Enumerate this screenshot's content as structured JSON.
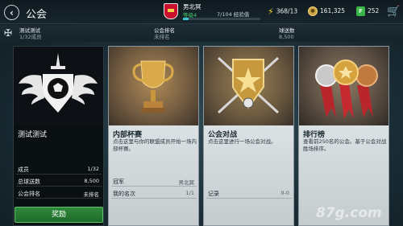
{
  "header": {
    "back_icon": "chevron-left-icon",
    "title": "公会",
    "profile": {
      "name": "男北冥",
      "level": "等级4",
      "xp_text": "7/104 经验值",
      "xp_fraction": 0.07,
      "badge_icon": "club-crest-icon"
    },
    "stats": {
      "energy": "368/13",
      "coins": "161,325",
      "points": "252"
    },
    "cart_icon": "shopping-cart-icon"
  },
  "guild_info": {
    "name": "测试测试",
    "members": "1/32成员",
    "rank_label": "公会排名",
    "rank_value": "未排名",
    "goals_label": "球送数",
    "goals_value": "8,500"
  },
  "cards": {
    "guild": {
      "title": "测试测试",
      "rows": [
        {
          "label": "成员",
          "value": "1/32"
        },
        {
          "label": "总球送数",
          "value": "8,500"
        },
        {
          "label": "公会排名",
          "value": "未排名"
        }
      ],
      "button": "奖励"
    },
    "cup": {
      "title": "内部杯赛",
      "desc": "点击这里与你的联盟成员开始一场内部杯赛。",
      "rows": [
        {
          "label": "冠军",
          "value": "男北冥"
        },
        {
          "label": "我的名次",
          "value": "1/1"
        }
      ]
    },
    "battle": {
      "title": "公会对战",
      "desc": "点击这里进行一场公会对战。",
      "rows": [
        {
          "label": "记录",
          "value": "0-0"
        }
      ]
    },
    "leaderboard": {
      "title": "排行榜",
      "desc": "查看前250名的公会。基于公会对战胜场排序。"
    }
  },
  "watermark": "87g.com",
  "colors": {
    "accent_green": "#2e8a3a",
    "xp_blue": "#3fc1d6",
    "level_green": "#49c76f",
    "coin_gold": "#c9a243"
  }
}
